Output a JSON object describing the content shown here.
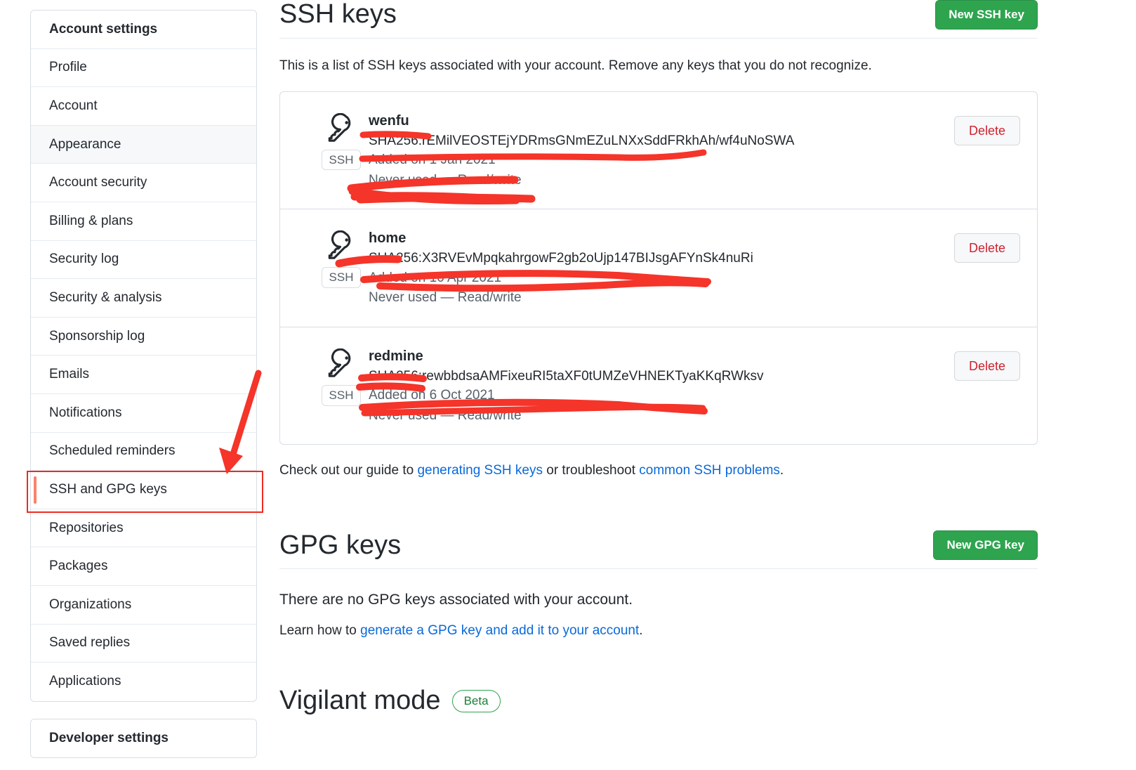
{
  "sidebar": {
    "account_items": [
      {
        "label": "Account settings",
        "kind": "header"
      },
      {
        "label": "Profile",
        "kind": "item"
      },
      {
        "label": "Account",
        "kind": "item"
      },
      {
        "label": "Appearance",
        "kind": "selected"
      },
      {
        "label": "Account security",
        "kind": "item"
      },
      {
        "label": "Billing & plans",
        "kind": "item"
      },
      {
        "label": "Security log",
        "kind": "item"
      },
      {
        "label": "Security & analysis",
        "kind": "item"
      },
      {
        "label": "Sponsorship log",
        "kind": "item"
      },
      {
        "label": "Emails",
        "kind": "item"
      },
      {
        "label": "Notifications",
        "kind": "item"
      },
      {
        "label": "Scheduled reminders",
        "kind": "item"
      },
      {
        "label": "SSH and GPG keys",
        "kind": "marked"
      },
      {
        "label": "Repositories",
        "kind": "item"
      },
      {
        "label": "Packages",
        "kind": "item"
      },
      {
        "label": "Organizations",
        "kind": "item"
      },
      {
        "label": "Saved replies",
        "kind": "item"
      },
      {
        "label": "Applications",
        "kind": "item"
      }
    ],
    "developer_items": [
      {
        "label": "Developer settings",
        "kind": "header"
      }
    ]
  },
  "ssh_section": {
    "title": "SSH keys",
    "new_key_button": "New SSH key",
    "description": "This is a list of SSH keys associated with your account. Remove any keys that you do not recognize.",
    "keys": [
      {
        "name": "wenfu",
        "fingerprint": "SHA256:rEMilVEOSTEjYDRmsGNmEZuLNXxSddFRkhAh/wf4uNoSWA",
        "added": "Added on 1 Jan 2021",
        "usage": "Never used — Read/write",
        "badge": "SSH",
        "delete_label": "Delete"
      },
      {
        "name": "home",
        "fingerprint": "SHA256:X3RVEvMpqkahrgowF2gb2oUjp147BIJsgAFYnSk4nuRi",
        "added": "Added on 10 Apr 2021",
        "usage": "Never used — Read/write",
        "badge": "SSH",
        "delete_label": "Delete"
      },
      {
        "name": "redmine",
        "fingerprint": "SHA256:rewbbdsaAMFixeuRI5taXF0tUMZeVHNEKTyaKKqRWksv",
        "added": "Added on 6 Oct 2021",
        "usage": "Never used — Read/write",
        "badge": "SSH",
        "delete_label": "Delete"
      }
    ],
    "guide": {
      "prefix": "Check out our guide to ",
      "link1": "generating SSH keys",
      "middle": " or troubleshoot ",
      "link2": "common SSH problems",
      "suffix": "."
    }
  },
  "gpg_section": {
    "title": "GPG keys",
    "new_key_button": "New GPG key",
    "empty_message": "There are no GPG keys associated with your account.",
    "learn": {
      "prefix": "Learn how to ",
      "link": "generate a GPG key and add it to your account",
      "suffix": "."
    }
  },
  "vigilant_section": {
    "title": "Vigilant mode",
    "badge": "Beta"
  },
  "colors": {
    "green_button": "#2ea44f",
    "link_blue": "#0969da",
    "delete_red": "#cf222e",
    "annotation_red": "#f5342a",
    "selected_bg": "#f6f8fa",
    "accent_orange": "#f9826c"
  }
}
